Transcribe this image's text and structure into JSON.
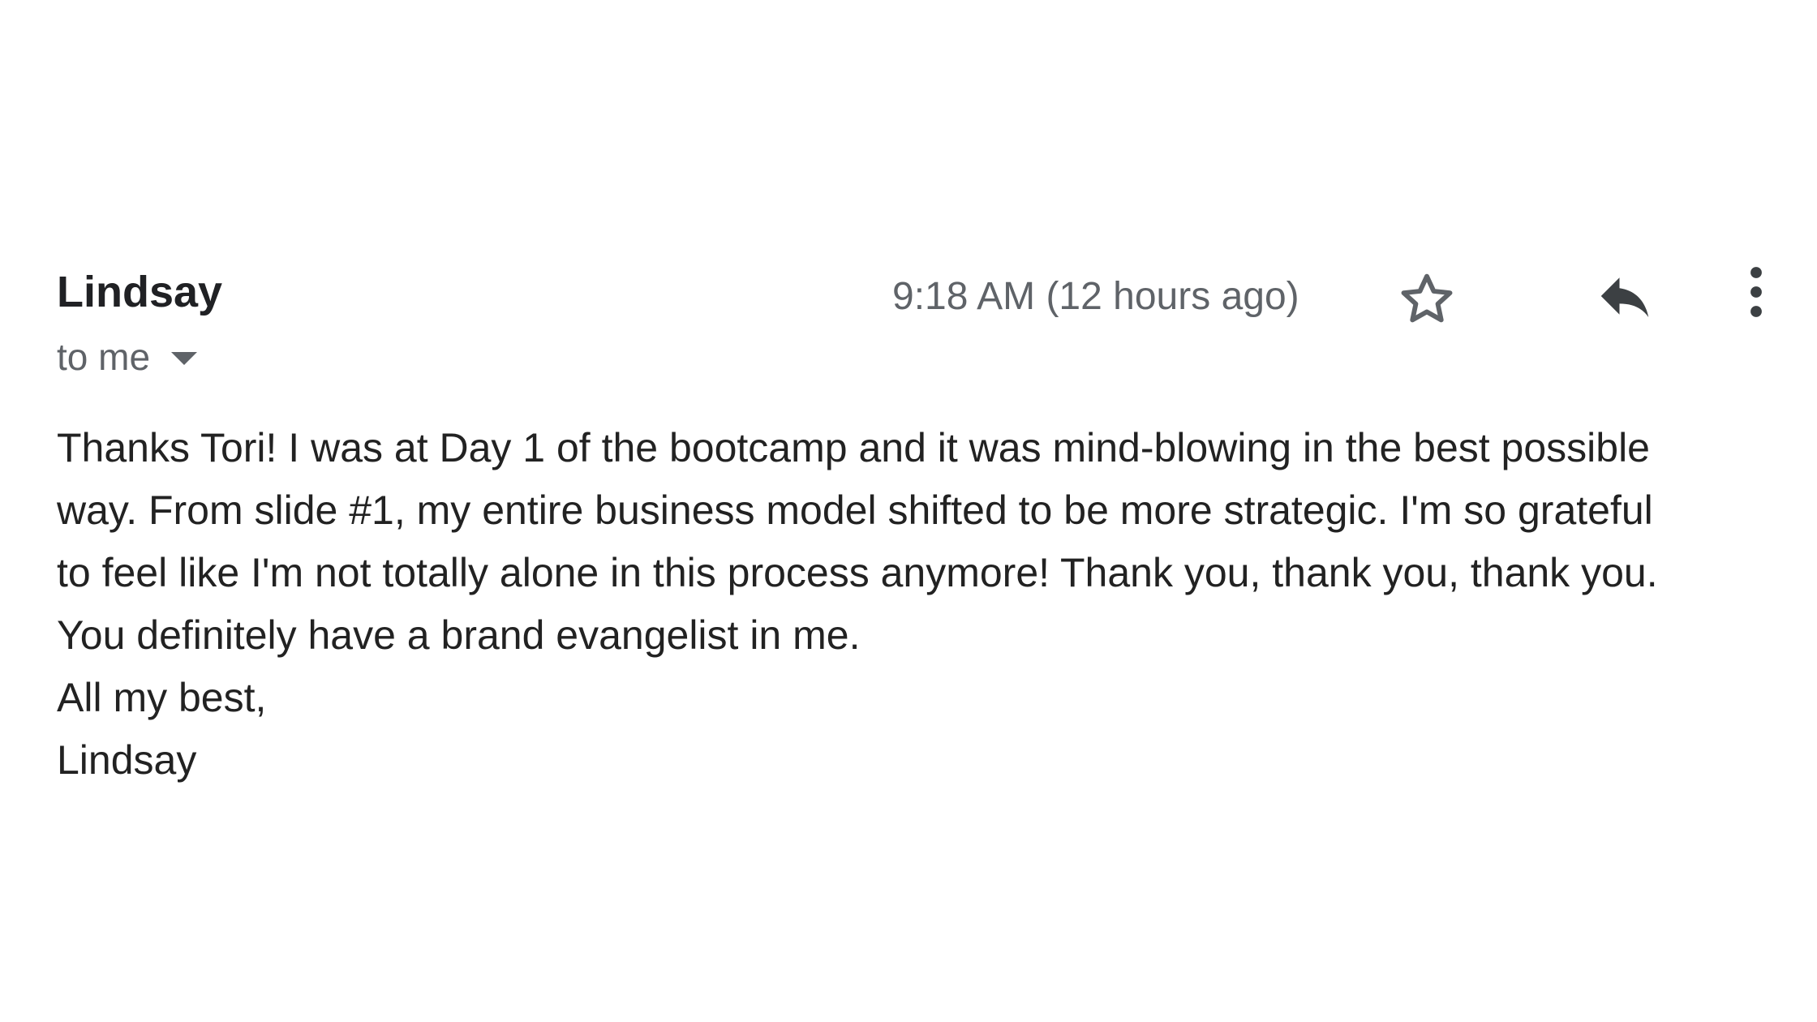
{
  "header": {
    "sender_name": "Lindsay",
    "recipient_label": "to me",
    "timestamp": "9:18 AM (12 hours ago)"
  },
  "actions": {
    "star_icon": "star-outline-icon",
    "reply_icon": "reply-icon",
    "more_icon": "more-vert-icon"
  },
  "body": {
    "lines": [
      "Thanks Tori! I was at Day 1 of the bootcamp and it was mind-blowing in the best possible",
      "way. From slide #1, my entire business model shifted to be more strategic. I'm so grateful",
      "to feel like I'm not totally alone in this process anymore! Thank you, thank you, thank you.",
      "You definitely have a brand evangelist in me.",
      "All my best,",
      "Lindsay"
    ]
  },
  "colors": {
    "primary_text": "#202124",
    "secondary_text": "#5f6368",
    "body_text": "#222222",
    "background": "#ffffff"
  }
}
